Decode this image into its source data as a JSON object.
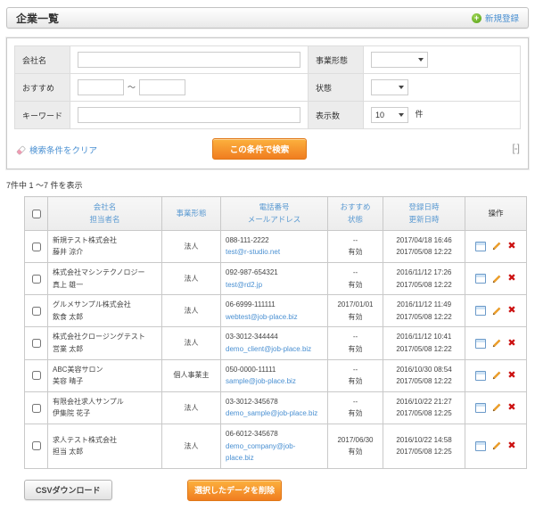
{
  "title_bar": {
    "title": "企業一覧",
    "new_link": "新規登録"
  },
  "search": {
    "company_name": {
      "label": "会社名",
      "value": ""
    },
    "business_type": {
      "label": "事業形態",
      "value": ""
    },
    "recommend": {
      "label": "おすすめ",
      "from": "",
      "to": "",
      "separator": "～"
    },
    "status": {
      "label": "状態",
      "value": ""
    },
    "keyword": {
      "label": "キーワード",
      "value": ""
    },
    "display_count": {
      "label": "表示数",
      "value": "10",
      "unit": "件"
    },
    "clear_link": "検索条件をクリア",
    "submit_button": "この条件で検索",
    "collapse_button": "[-]"
  },
  "results": {
    "summary": "7件中 1 ～7 件を表示"
  },
  "table": {
    "headers": {
      "company_line1": "会社名",
      "company_line2": "担当者名",
      "business": "事業形態",
      "contact_line1": "電話番号",
      "contact_line2": "メールアドレス",
      "recommend_line1": "おすすめ",
      "recommend_line2": "状態",
      "date_line1": "登録日時",
      "date_line2": "更新日時",
      "operation": "操作"
    },
    "rows": [
      {
        "company": "新規テスト株式会社",
        "person": "藤井 涼介",
        "business": "法人",
        "phone": "088-111-2222",
        "email": "test@r-studio.net",
        "recommend": "--",
        "status": "有効",
        "registered": "2017/04/18 16:46",
        "updated": "2017/05/08 12:22"
      },
      {
        "company": "株式会社マシンテクノロジー",
        "person": "真上 雄一",
        "business": "法人",
        "phone": "092-987-654321",
        "email": "test@rd2.jp",
        "recommend": "--",
        "status": "有効",
        "registered": "2016/11/12 17:26",
        "updated": "2017/05/08 12:22"
      },
      {
        "company": "グルメサンプル株式会社",
        "person": "飲食 太郎",
        "business": "法人",
        "phone": "06-6999-111111",
        "email": "webtest@job-place.biz",
        "recommend": "2017/01/01",
        "status": "有効",
        "registered": "2016/11/12 11:49",
        "updated": "2017/05/08 12:22"
      },
      {
        "company": "株式会社クロージングテスト",
        "person": "営業 太郎",
        "business": "法人",
        "phone": "03-3012-344444",
        "email": "demo_client@job-place.biz",
        "recommend": "--",
        "status": "有効",
        "registered": "2016/11/12 10:41",
        "updated": "2017/05/08 12:22"
      },
      {
        "company": "ABC美容サロン",
        "person": "美容 晴子",
        "business": "個人事業主",
        "phone": "050-0000-11111",
        "email": "sample@job-place.biz",
        "recommend": "--",
        "status": "有効",
        "registered": "2016/10/30 08:54",
        "updated": "2017/05/08 12:22"
      },
      {
        "company": "有限会社求人サンプル",
        "person": "伊集院 花子",
        "business": "法人",
        "phone": "03-3012-345678",
        "email": "demo_sample@job-place.biz",
        "recommend": "--",
        "status": "有効",
        "registered": "2016/10/22 21:27",
        "updated": "2017/05/08 12:25"
      },
      {
        "company": "求人テスト株式会社",
        "person": "担当 太郎",
        "business": "法人",
        "phone": "06-6012-345678",
        "email": "demo_company@job-place.biz",
        "recommend": "2017/06/30",
        "status": "有効",
        "registered": "2016/10/22 14:58",
        "updated": "2017/05/08 12:25"
      }
    ]
  },
  "footer": {
    "csv_button": "CSVダウンロード",
    "delete_button": "選択したデータを削除"
  },
  "icons": {
    "new": "plus-circle-icon",
    "clear": "eraser-icon",
    "view": "detail-window-icon",
    "edit": "pencil-icon",
    "delete": "x-mark-icon"
  },
  "colors": {
    "accent_orange": "#f07d20",
    "link_blue": "#4a90d2",
    "header_link_blue": "#5b9ad2",
    "success_green": "#55a015",
    "delete_red": "#cc1111",
    "label_bg": "#ececec"
  }
}
